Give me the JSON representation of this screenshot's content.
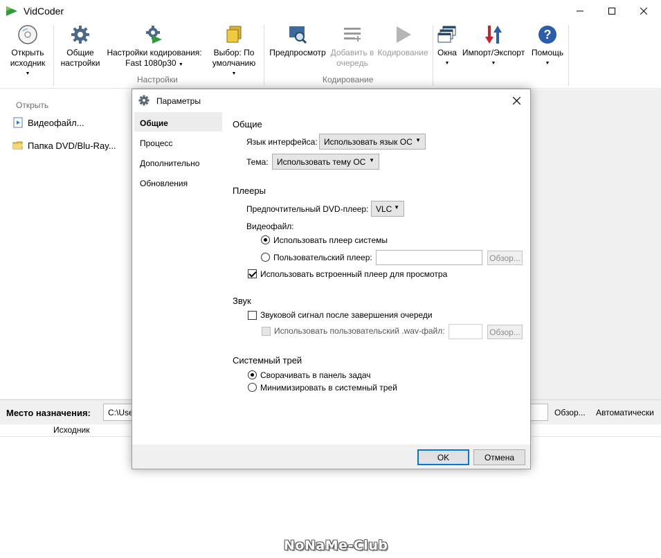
{
  "window": {
    "title": "VidCoder"
  },
  "ribbon": {
    "open_source": "Открыть исходник",
    "general_settings": "Общие настройки",
    "encoding_settings": "Настройки кодирования:",
    "encoding_preset": "Fast 1080p30",
    "pick_default": "Выбор: По умолчанию",
    "settings_group": "Настройки",
    "preview": "Предпросмотр",
    "add_to_queue": "Добавить в очередь",
    "encode": "Кодирование",
    "encoding_group": "Кодирование",
    "windows": "Окна",
    "import_export": "Импорт/Экспорт",
    "help": "Помощь"
  },
  "source": {
    "heading": "Открыть",
    "video_file": "Видеофайл...",
    "dvd_folder": "Папка DVD/Blu-Ray..."
  },
  "destination": {
    "label": "Место назначения:",
    "path": "C:\\Use",
    "browse": "Обзор...",
    "auto": "Автоматически"
  },
  "queue": {
    "column_source": "Исходник"
  },
  "watermark": "NoNaMe-Club",
  "dialog": {
    "title": "Параметры",
    "nav": [
      "Общие",
      "Процесс",
      "Дополнительно",
      "Обновления"
    ],
    "general": {
      "section": "Общие",
      "language_label": "Язык интерфейса:",
      "language_value": "Использовать язык ОС",
      "theme_label": "Тема:",
      "theme_value": "Использовать тему ОС"
    },
    "players": {
      "section": "Плееры",
      "dvd_player_label": "Предпочтительный DVD-плеер:",
      "dvd_player_value": "VLC",
      "video_file_label": "Видеофайл:",
      "system_player": "Использовать плеер системы",
      "custom_player": "Пользовательский плеер:",
      "browse": "Обзор...",
      "builtin_player": "Использовать встроенный плеер для просмотра"
    },
    "sound": {
      "section": "Звук",
      "beep": "Звуковой сигнал после завершения очереди",
      "custom_wav": "Использовать пользовательский .wav-файл:",
      "browse": "Обзор..."
    },
    "tray": {
      "section": "Системный трей",
      "minimize_taskbar": "Сворачивать в панель задач",
      "minimize_tray": "Минимизировать в системный трей"
    },
    "ok": "OK",
    "cancel": "Отмена"
  },
  "colors": {
    "accent": "#0078d7",
    "dialog_bg": "#f0f0f0"
  }
}
